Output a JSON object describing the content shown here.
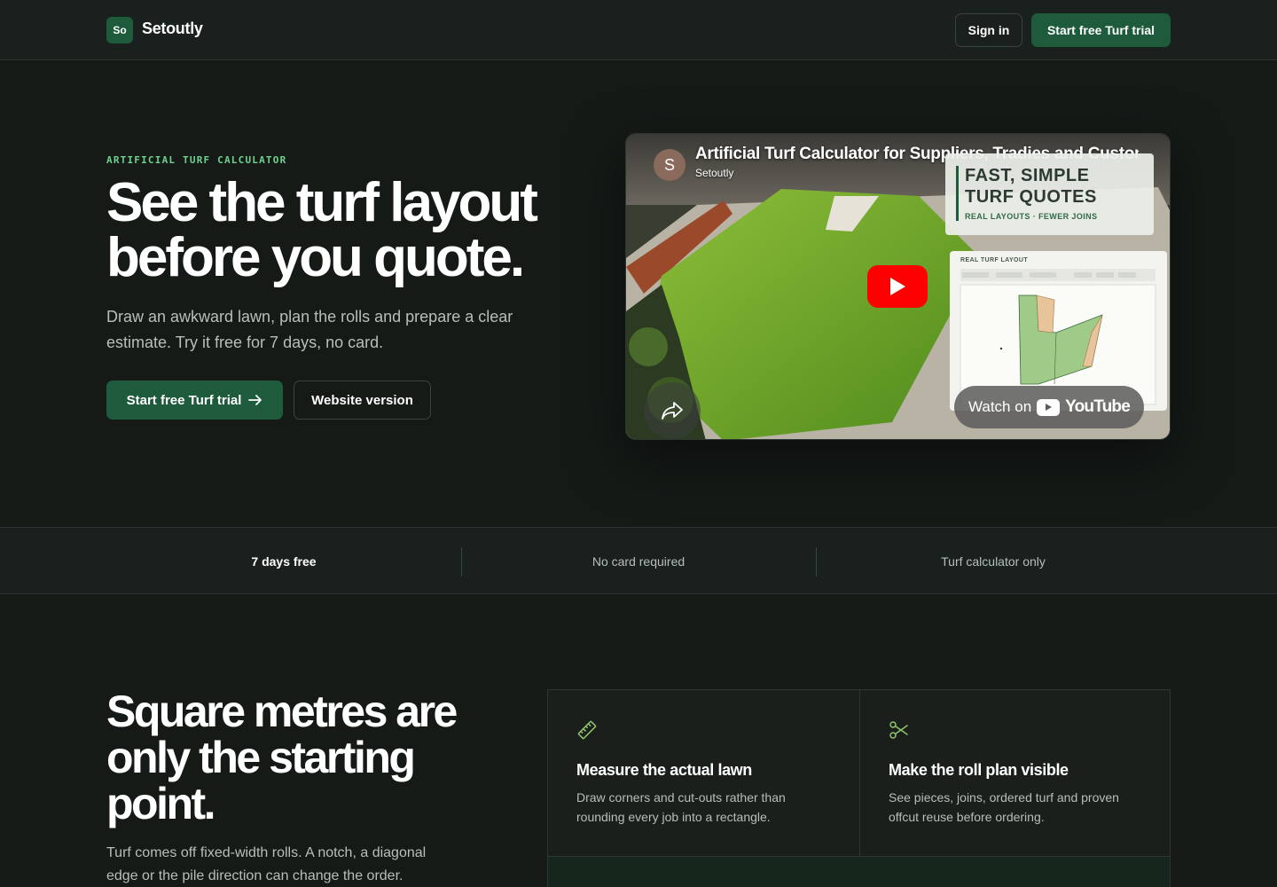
{
  "brand": {
    "mark": "So",
    "name": "Setoutly"
  },
  "nav": {
    "signin_label": "Sign in",
    "trial_label": "Start free Turf trial"
  },
  "hero": {
    "eyebrow": "ARTIFICIAL TURF CALCULATOR",
    "title": "See the turf layout before you quote.",
    "subtitle": "Draw an awkward lawn, plan the rolls and prepare a clear estimate. Try it free for 7 days, no card.",
    "primary_cta": "Start free Turf trial",
    "secondary_cta": "Website version"
  },
  "video": {
    "avatar_letter": "S",
    "title": "Artificial Turf Calculator for Suppliers, Tradies and Customers",
    "channel": "Setoutly",
    "overlay_line1": "FAST, SIMPLE",
    "overlay_line2": "TURF QUOTES",
    "overlay_tag": "REAL LAYOUTS · FEWER JOINS",
    "layout_card_title": "REAL TURF LAYOUT",
    "watch_on": "Watch on",
    "youtube_word": "YouTube"
  },
  "strip": {
    "items": [
      "7 days free",
      "No card required",
      "Turf calculator only"
    ]
  },
  "section": {
    "title": "Square metres are only the starting point.",
    "subtitle": "Turf comes off fixed-width rolls. A notch, a diagonal edge or the pile direction can change the order."
  },
  "features": [
    {
      "icon": "ruler-icon",
      "title": "Measure the actual lawn",
      "desc": "Draw corners and cut-outs rather than rounding every job into a rectangle."
    },
    {
      "icon": "scissors-icon",
      "title": "Make the roll plan visible",
      "desc": "See pieces, joins, ordered turf and proven offcut reuse before ordering."
    }
  ],
  "colors": {
    "accent": "#1e5a3c",
    "eyebrow": "#6fd18f",
    "background": "#151a17",
    "youtube_red": "#ff0000"
  }
}
